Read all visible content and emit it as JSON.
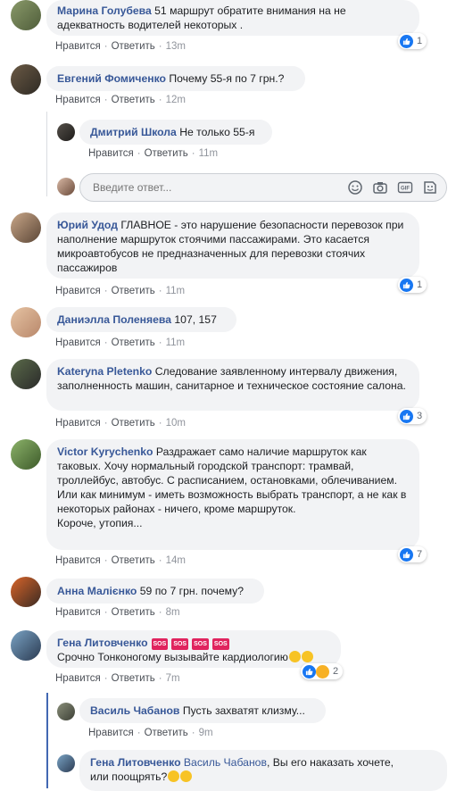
{
  "actions": {
    "like": "Нравится",
    "reply": "Ответить"
  },
  "comments": [
    {
      "author": "Марина Голубева",
      "text": "51 маршрут обратите внимания на не адекватность водителей некоторых .",
      "time": "13m",
      "reactions": "1"
    },
    {
      "author": "Евгений Фомиченко",
      "text": "Почему 55-я по 7 грн.?",
      "time": "12m"
    },
    {
      "author": "Дмитрий Школа",
      "text": "Не только 55-я",
      "time": "11m"
    },
    {
      "author": "Юрий Удод",
      "text": "ГЛАВНОЕ - это нарушение безопасности перевозок при наполнение маршруток стоячими пассажирами. Это касается микроавтобусов не предназначенных для перевозки стоячих пассажиров",
      "time": "11m",
      "reactions": "1"
    },
    {
      "author": "Даниэлла Поленяева",
      "text": "107, 157",
      "time": "11m"
    },
    {
      "author": "Kateryna Pletenko",
      "text": "Следование заявленному интервалу движения, заполненность машин, санитарное и техническое состояние салона.",
      "time": "10m",
      "reactions": "3"
    },
    {
      "author": "Victor Kyrychenko",
      "text": "Раздражает само наличие маршруток как таковых. Хочу нормальный городской транспорт: трамвай, троллейбус, автобус. С расписанием, остановками, облечиванием. Или как минимум - иметь возможность выбрать транспорт, а не как в некоторых районах - ничего, кроме маршруток.",
      "text2": "Короче, утопия...",
      "time": "14m",
      "reactions": "7"
    },
    {
      "author": "Анна Малієнко",
      "text": "59 по 7 грн. почему?",
      "time": "8m"
    },
    {
      "author": "Гена Литовченко",
      "badge": "SOS",
      "text": "Срочно Тонконогому вызывайте кардиологию",
      "time": "7m",
      "reactions": "2"
    },
    {
      "author": "Василь Чабанов",
      "text": "Пусть захватят клизму...",
      "time": "9m"
    },
    {
      "author": "Гена Литовченко",
      "mention": "Василь Чабанов",
      "text": ", Вы его наказать хочете,",
      "text2": "или поощрять?"
    }
  ],
  "reply_placeholder": "Введите ответ...",
  "colors": {
    "author": "#385898",
    "bubble": "#f2f3f5",
    "like": "#1877f2",
    "sos": "#e0245e"
  }
}
